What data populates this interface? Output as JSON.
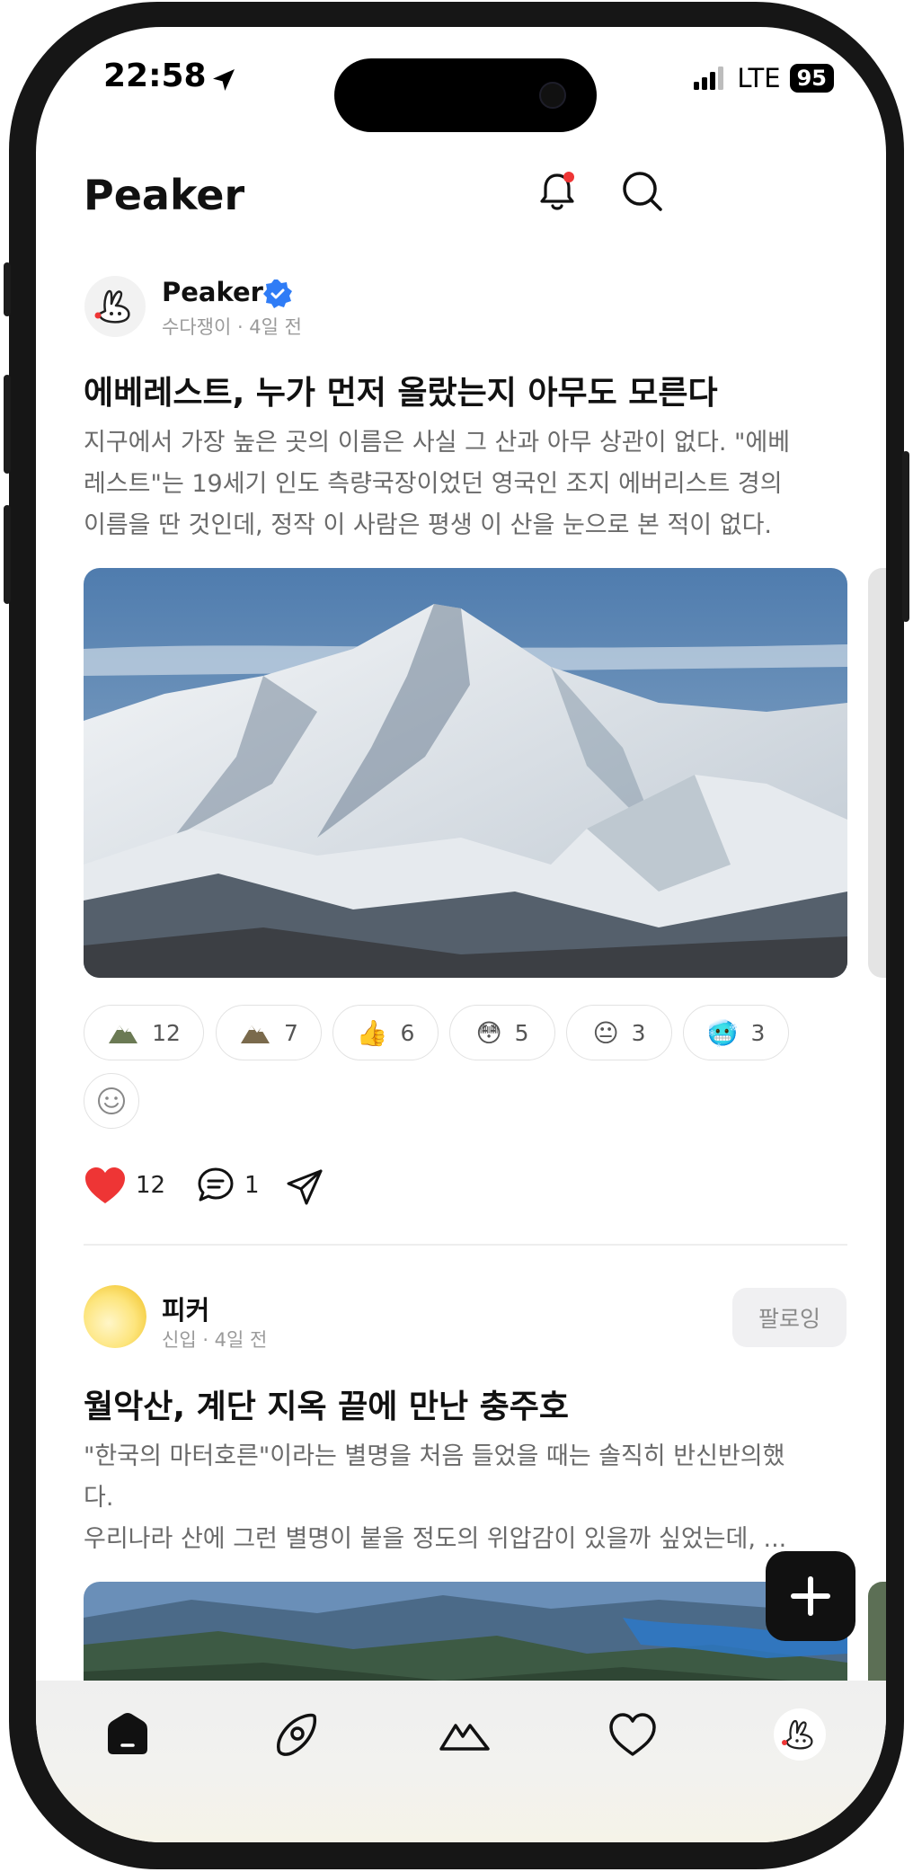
{
  "status_bar": {
    "time": "22:58",
    "network": "LTE",
    "battery": "95"
  },
  "header": {
    "title": "Peaker"
  },
  "post1": {
    "author": "Peaker",
    "meta": "수다쟁이 · 4일 전",
    "title": "에베레스트, 누가 먼저 올랐는지 아무도 모른다",
    "body_lines": [
      "지구에서 가장 높은 곳의 이름은 사실 그 산과 아무 상관이 없다. \"에베",
      "레스트\"는 19세기 인도 측량국장이었던 영국인 조지 에버리스트 경의",
      "이름을 딴 것인데, 정작 이 사람은 평생 이 산을 눈으로 본 적이 없다."
    ],
    "reactions": [
      {
        "icon": "mountain-icon",
        "emoji": "🏔",
        "count": "12"
      },
      {
        "icon": "mountain-icon",
        "emoji": "🏔",
        "count": "7"
      },
      {
        "icon": "thumbs-up-icon",
        "emoji": "👍",
        "count": "6"
      },
      {
        "icon": "flushed-face-icon",
        "emoji": "😳",
        "count": "5"
      },
      {
        "icon": "neutral-face-icon",
        "emoji": "😐",
        "count": "3"
      },
      {
        "icon": "cold-face-icon",
        "emoji": "🥶",
        "count": "3"
      }
    ],
    "likes": "12",
    "comments": "1"
  },
  "post2": {
    "author": "피커",
    "meta": "신입 · 4일 전",
    "follow_label": "팔로잉",
    "title": "월악산, 계단 지옥 끝에 만난 충주호",
    "body_lines": [
      "\"한국의 마터호른\"이라는 별명을 처음 들었을 때는 솔직히 반신반의했",
      "다.",
      "우리나라 산에 그런 별명이 붙을 정도의 위압감이 있을까 싶었는데, ..."
    ]
  },
  "tabbar": [
    "home-icon",
    "explore-icon",
    "mountain-icon",
    "heart-icon",
    "profile-avatar"
  ],
  "colors": {
    "accent_red": "#ee3535",
    "verified_blue": "#2f7cf6",
    "text_dark": "#111111"
  }
}
